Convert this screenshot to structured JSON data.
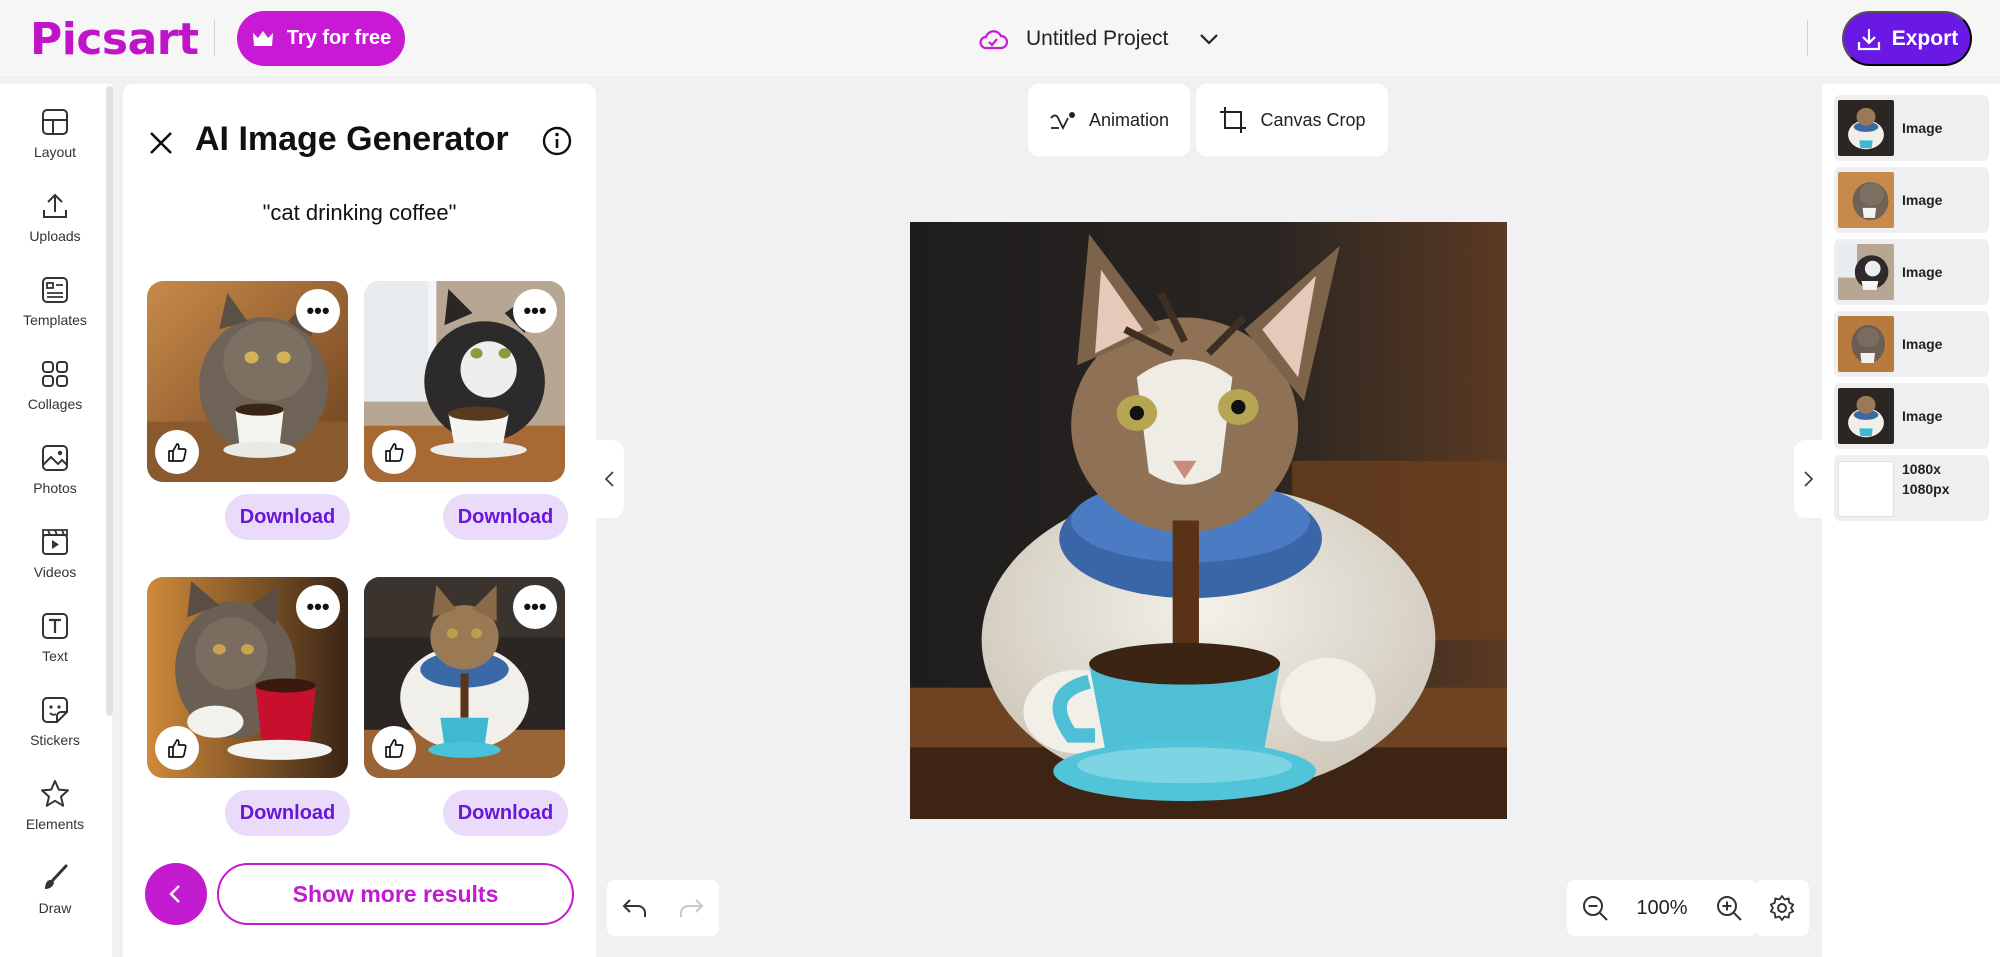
{
  "header": {
    "logo": "Picsart",
    "try_label": "Try for free",
    "project_name": "Untitled Project",
    "export_label": "Export"
  },
  "rail": {
    "items": [
      {
        "label": "Layout",
        "icon": "layout-icon"
      },
      {
        "label": "Uploads",
        "icon": "upload-icon"
      },
      {
        "label": "Templates",
        "icon": "templates-icon"
      },
      {
        "label": "Collages",
        "icon": "collages-icon"
      },
      {
        "label": "Photos",
        "icon": "photos-icon"
      },
      {
        "label": "Videos",
        "icon": "videos-icon"
      },
      {
        "label": "Text",
        "icon": "text-icon"
      },
      {
        "label": "Stickers",
        "icon": "stickers-icon"
      },
      {
        "label": "Elements",
        "icon": "star-icon"
      },
      {
        "label": "Draw",
        "icon": "brush-icon"
      }
    ]
  },
  "panel": {
    "title": "AI Image Generator",
    "prompt": "\"cat drinking coffee\"",
    "download_label": "Download",
    "more_label": "Show more results"
  },
  "toolbar": {
    "animation_label": "Animation",
    "crop_label": "Canvas Crop"
  },
  "zoom": {
    "level": "100%"
  },
  "layers": [
    {
      "label": "Image"
    },
    {
      "label": "Image"
    },
    {
      "label": "Image"
    },
    {
      "label": "Image"
    },
    {
      "label": "Image"
    },
    {
      "label": "1080x\n1080px"
    }
  ],
  "colors": {
    "brand": "#c81ad4",
    "export": "#6a18e3",
    "download_bg": "#eadbfb",
    "download_text": "#6a16d8"
  }
}
